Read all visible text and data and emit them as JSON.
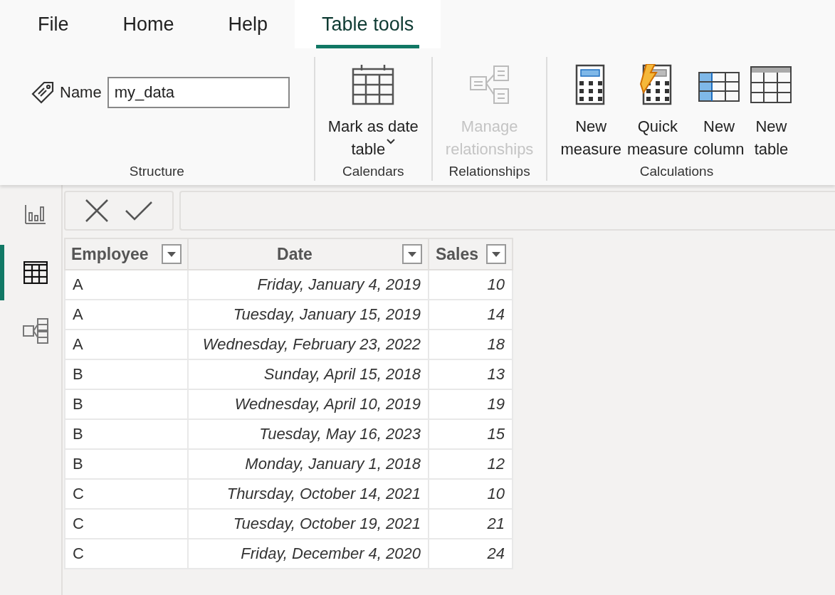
{
  "tabs": [
    {
      "label": "File",
      "selected": false
    },
    {
      "label": "Home",
      "selected": false
    },
    {
      "label": "Help",
      "selected": false
    },
    {
      "label": "Table tools",
      "selected": true
    }
  ],
  "ribbon": {
    "groups": [
      {
        "label": "Structure",
        "kind": "name",
        "field_label": "Name",
        "value": "my_data"
      },
      {
        "label": "Calendars",
        "kind": "buttons",
        "buttons": [
          {
            "kind": "calendar",
            "lines": [
              "Mark as date",
              "table"
            ],
            "dropdown": true,
            "disabled": false
          }
        ]
      },
      {
        "label": "Relationships",
        "kind": "buttons",
        "buttons": [
          {
            "kind": "relationships",
            "lines": [
              "Manage",
              "relationships"
            ],
            "dropdown": false,
            "disabled": true
          }
        ]
      },
      {
        "label": "Calculations",
        "kind": "buttons",
        "buttons": [
          {
            "kind": "measure",
            "lines": [
              "New",
              "measure"
            ],
            "dropdown": false,
            "disabled": false
          },
          {
            "kind": "quick",
            "lines": [
              "Quick",
              "measure"
            ],
            "dropdown": false,
            "disabled": false
          },
          {
            "kind": "column",
            "lines": [
              "New",
              "column"
            ],
            "dropdown": false,
            "disabled": false
          },
          {
            "kind": "table",
            "lines": [
              "New",
              "table"
            ],
            "dropdown": false,
            "disabled": false
          }
        ]
      }
    ]
  },
  "views": [
    {
      "kind": "report",
      "selected": false
    },
    {
      "kind": "table",
      "selected": true
    },
    {
      "kind": "model",
      "selected": false
    }
  ],
  "table": {
    "columns": [
      {
        "label": "Employee"
      },
      {
        "label": "Date"
      },
      {
        "label": "Sales"
      }
    ],
    "rows": [
      [
        "A",
        "Friday, January 4, 2019",
        "10"
      ],
      [
        "A",
        "Tuesday, January 15, 2019",
        "14"
      ],
      [
        "A",
        "Wednesday, February 23, 2022",
        "18"
      ],
      [
        "B",
        "Sunday, April 15, 2018",
        "13"
      ],
      [
        "B",
        "Wednesday, April 10, 2019",
        "19"
      ],
      [
        "B",
        "Tuesday, May 16, 2023",
        "15"
      ],
      [
        "B",
        "Monday, January 1, 2018",
        "12"
      ],
      [
        "C",
        "Thursday, October 14, 2021",
        "10"
      ],
      [
        "C",
        "Tuesday, October 19, 2021",
        "21"
      ],
      [
        "C",
        "Friday, December 4, 2020",
        "24"
      ]
    ]
  }
}
